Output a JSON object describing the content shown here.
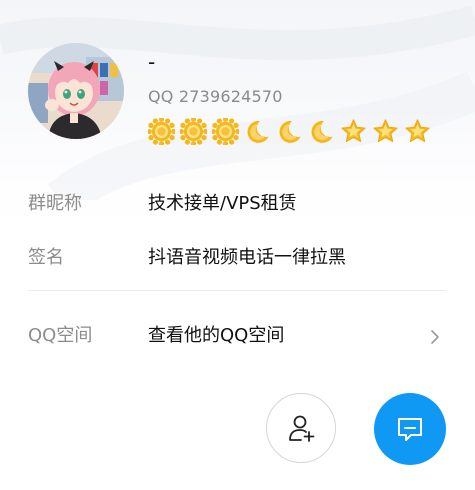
{
  "profile": {
    "nickname": "-",
    "qq_number": "QQ 2739624570",
    "level_icons": [
      "sun-icon",
      "sun-icon",
      "sun-icon",
      "moon-icon",
      "moon-icon",
      "moon-icon",
      "star-icon",
      "star-icon",
      "star-icon"
    ]
  },
  "rows": {
    "group_nickname": {
      "label": "群昵称",
      "value": "技术接单/VPS租赁"
    },
    "signature": {
      "label": "签名",
      "value": "抖语音视频电话一律拉黑"
    },
    "qzone": {
      "label": "QQ空间",
      "value": "查看他的QQ空间"
    }
  },
  "actions": {
    "add_friend_icon": "add-friend-icon",
    "chat_icon": "chat-icon"
  },
  "colors": {
    "chat_button": "#0f99f5",
    "badge_gold": "#f5b71a",
    "label_gray": "#8c8c8c"
  }
}
